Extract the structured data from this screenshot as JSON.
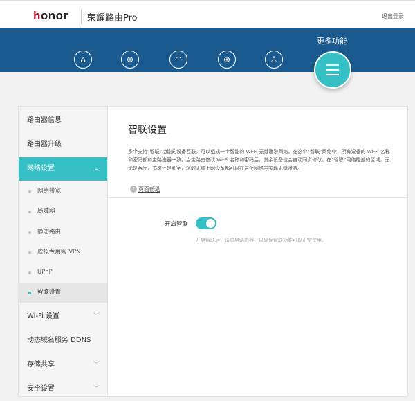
{
  "header": {
    "brand": "honor",
    "product": "荣耀路由Pro",
    "logout": "退出登录"
  },
  "nav": {
    "items": [
      "home",
      "internet",
      "wifi",
      "network",
      "user"
    ],
    "more_label": "更多功能"
  },
  "sidebar": {
    "items": [
      {
        "label": "路由器信息"
      },
      {
        "label": "路由器升级"
      },
      {
        "label": "网络设置"
      }
    ],
    "subitems": [
      {
        "label": "网络带宽"
      },
      {
        "label": "局域网"
      },
      {
        "label": "静态路由"
      },
      {
        "label": "虚拟专用网 VPN"
      },
      {
        "label": "UPnP"
      },
      {
        "label": "智联设置"
      }
    ],
    "bottom": [
      {
        "label": "Wi-Fi 设置"
      },
      {
        "label": "动态域名服务 DDNS"
      },
      {
        "label": "存储共享"
      },
      {
        "label": "安全设置"
      }
    ]
  },
  "main": {
    "title": "智联设置",
    "description": "多个支持“智联”功能的设备互联，可以组成一个智能的 Wi-Fi 无缝漫游网络。在这个“智联”网络中，所有设备的 Wi-Fi 名称和密码都和主路由器一致。当主路由修改 Wi-Fi 名称和密码后，其余设备也会自动同步修改。在“智联”网络覆盖的区域，无论是客厅，书房还是卧室，您的无线上网设备都可以在这个网络中实现无缝漫游。",
    "help": "页面帮助",
    "toggle_label": "开启智联",
    "toggle_on": true,
    "hint": "开启智联后，请重启路由器，以确保智联功能可以正常使用。"
  },
  "colors": {
    "accent": "#36bfc5",
    "band": "#1a5a8e"
  }
}
